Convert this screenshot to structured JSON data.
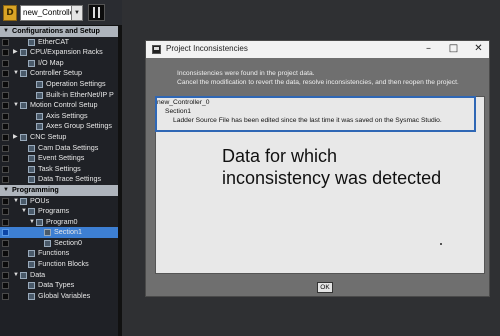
{
  "controller": {
    "icon_letter": "D",
    "name": "new_Controller_0"
  },
  "tree": [
    {
      "label": "Configurations and Setup",
      "indent": 0,
      "twisty": "▼",
      "header": true
    },
    {
      "label": "EtherCAT",
      "indent": 2,
      "twisty": "",
      "icon": "ethercat-icon"
    },
    {
      "label": "CPU/Expansion Racks",
      "indent": 1,
      "twisty": "▶",
      "icon": "rack-icon"
    },
    {
      "label": "I/O Map",
      "indent": 2,
      "twisty": "",
      "icon": "io-map-icon"
    },
    {
      "label": "Controller Setup",
      "indent": 1,
      "twisty": "▼",
      "icon": "controller-setup-icon"
    },
    {
      "label": "Operation Settings",
      "indent": 3,
      "twisty": "",
      "icon": "settings-icon"
    },
    {
      "label": "Built-in EtherNet/IP P",
      "indent": 3,
      "twisty": "",
      "icon": "network-icon"
    },
    {
      "label": "Motion Control Setup",
      "indent": 1,
      "twisty": "▼",
      "icon": "motion-icon"
    },
    {
      "label": "Axis Settings",
      "indent": 3,
      "twisty": "",
      "icon": "axis-icon"
    },
    {
      "label": "Axes Group Settings",
      "indent": 3,
      "twisty": "",
      "icon": "axes-group-icon"
    },
    {
      "label": "CNC Setup",
      "indent": 1,
      "twisty": "▶",
      "icon": "cnc-icon"
    },
    {
      "label": "Cam Data Settings",
      "indent": 2,
      "twisty": "",
      "icon": "cam-icon"
    },
    {
      "label": "Event Settings",
      "indent": 2,
      "twisty": "",
      "icon": "event-icon"
    },
    {
      "label": "Task Settings",
      "indent": 2,
      "twisty": "",
      "icon": "task-icon"
    },
    {
      "label": "Data Trace Settings",
      "indent": 2,
      "twisty": "",
      "icon": "trace-icon"
    },
    {
      "label": "Programming",
      "indent": 0,
      "twisty": "▼",
      "header": true
    },
    {
      "label": "POUs",
      "indent": 1,
      "twisty": "▼",
      "icon": "pou-icon"
    },
    {
      "label": "Programs",
      "indent": 2,
      "twisty": "▼",
      "icon": "programs-icon"
    },
    {
      "label": "Program0",
      "indent": 3,
      "twisty": "▼",
      "icon": "program-icon"
    },
    {
      "label": "Section1",
      "indent": 4,
      "twisty": "",
      "icon": "section-icon",
      "selected": true
    },
    {
      "label": "Section0",
      "indent": 4,
      "twisty": "",
      "icon": "section-icon"
    },
    {
      "label": "Functions",
      "indent": 2,
      "twisty": "",
      "icon": "functions-icon"
    },
    {
      "label": "Function Blocks",
      "indent": 2,
      "twisty": "",
      "icon": "function-blocks-icon"
    },
    {
      "label": "Data",
      "indent": 1,
      "twisty": "▼",
      "icon": "data-icon"
    },
    {
      "label": "Data Types",
      "indent": 2,
      "twisty": "",
      "icon": "data-types-icon"
    },
    {
      "label": "Global Variables",
      "indent": 2,
      "twisty": "",
      "icon": "global-variables-icon"
    }
  ],
  "dialog": {
    "title": "Project Inconsistencies",
    "minimize": "–",
    "maximize": "□",
    "close": "✕",
    "message_line1": "Inconsistencies were found in the project data.",
    "message_line2": "Cancel the modification to revert the data, resolve inconsistencies, and then reopen the project.",
    "items": {
      "controller": "new_Controller_0",
      "section": "Section1",
      "detail": "Ladder Source File has been edited since the last time it was saved on the Sysmac Studio."
    },
    "ok_label": "OK"
  },
  "annotation": {
    "line1": "Data for which",
    "line2": "inconsistency was detected"
  },
  "colors": {
    "selected": "#3d7fd3",
    "header": "#aeb4bc",
    "highlight_border": "#2f67b5"
  }
}
